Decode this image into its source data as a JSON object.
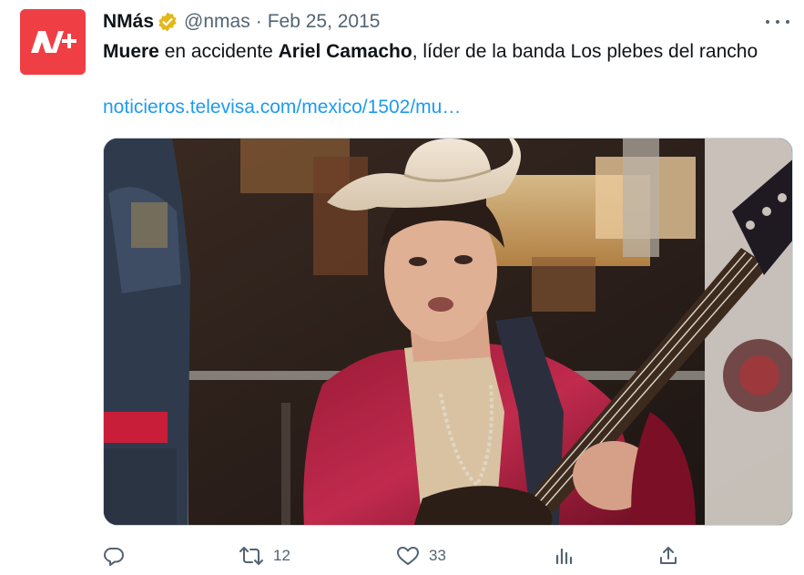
{
  "account": {
    "display_name": "NMás",
    "handle": "@nmas",
    "separator": "·",
    "date": "Feb 25, 2015",
    "avatar_text": "N+",
    "brand_color": "#ef3f45",
    "verified_color": "#e2b719"
  },
  "tweet": {
    "text_bold_1": "Muere",
    "text_part_1": " en accidente ",
    "text_bold_2": "Ariel Camacho",
    "text_part_2": ", líder de la banda Los plebes del rancho",
    "link_text": "noticieros.televisa.com/mexico/1502/mu…",
    "link_color": "#1d9bf0",
    "media_icon": "video-still-image"
  },
  "actions": {
    "reply_icon": "reply-icon",
    "retweet_icon": "retweet-icon",
    "retweet_count": "12",
    "like_icon": "heart-icon",
    "like_count": "33",
    "views_icon": "analytics-icon",
    "share_icon": "share-icon",
    "icon_color": "#536471"
  },
  "menu": {
    "more_icon": "more-icon"
  }
}
